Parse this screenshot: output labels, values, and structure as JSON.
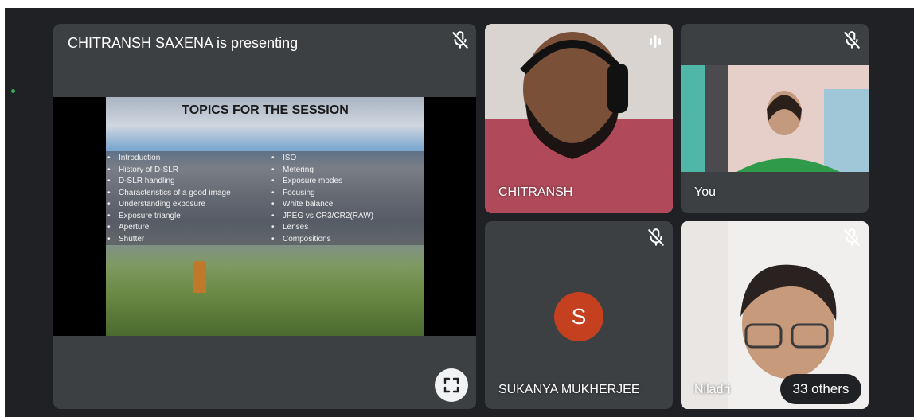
{
  "presenter_tile": {
    "title": "CHITRANSH SAXENA is presenting"
  },
  "slide": {
    "title": "TOPICS FOR THE SESSION",
    "topics_left": [
      "Introduction",
      "History of D-SLR",
      "D-SLR handling",
      "Characteristics of a good image",
      "Understanding exposure",
      "Exposure triangle",
      "Aperture",
      "Shutter"
    ],
    "topics_right": [
      "ISO",
      "Metering",
      "Exposure modes",
      "Focusing",
      "White balance",
      "JPEG vs CR3/CR2(RAW)",
      "Lenses",
      "Compositions"
    ]
  },
  "participants": [
    {
      "name": "CHITRANSH",
      "state": "speaking"
    },
    {
      "name": "You",
      "state": "muted"
    },
    {
      "name": "SUKANYA MUKHERJEE",
      "avatar_letter": "S",
      "avatar_color": "#c5401f",
      "state": "muted"
    },
    {
      "name": "Niladri",
      "state": "muted"
    }
  ],
  "others_count_label": "33 others",
  "icons": {
    "mic_off": "mic-off-icon",
    "speaking": "audio-level-icon",
    "fullscreen": "fullscreen-icon"
  },
  "colors": {
    "background": "#202124",
    "tile": "#3c4043",
    "active_dot": "#34a853"
  }
}
